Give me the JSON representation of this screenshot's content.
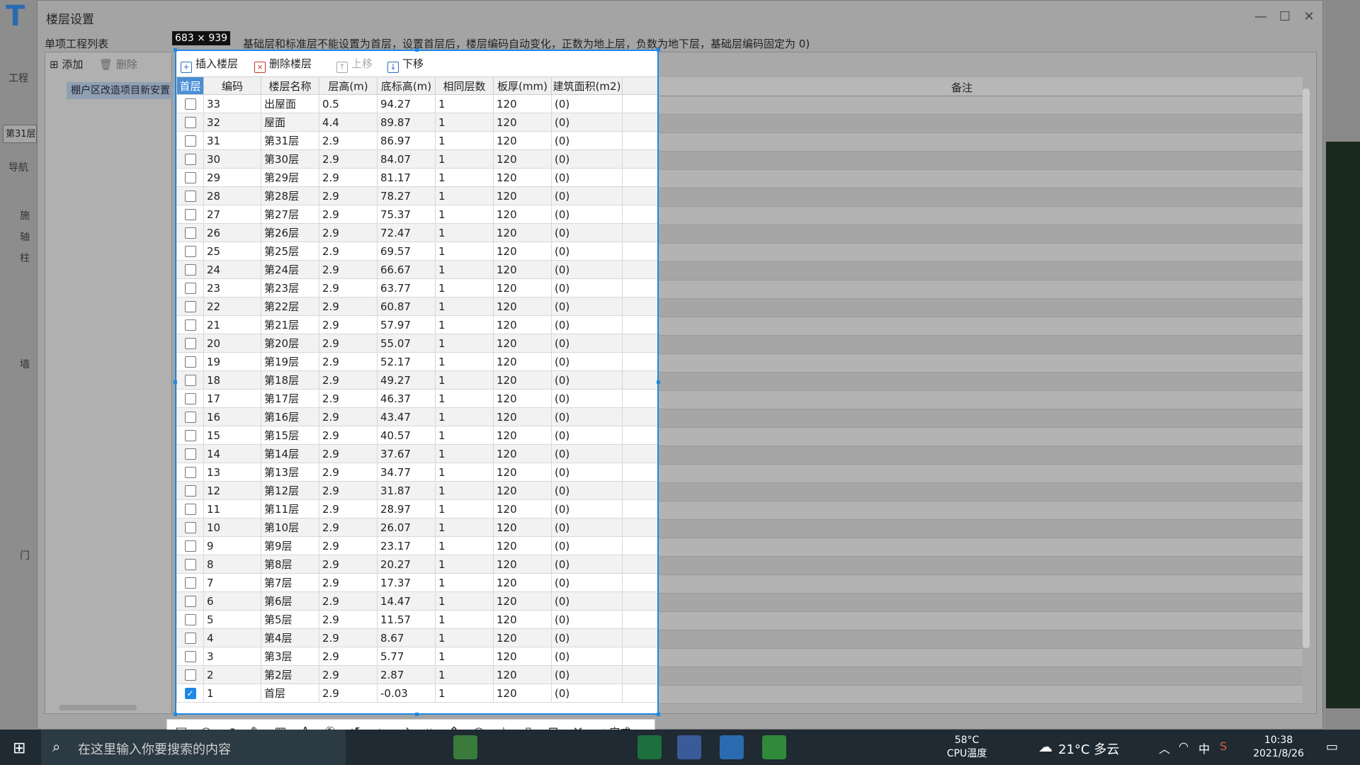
{
  "background_app": {
    "side_labels": [
      "工程",
      "导航",
      "施",
      "轴",
      "柱",
      "墙",
      "门"
    ],
    "floor_tab": "第31层"
  },
  "dialog": {
    "title": "楼层设置",
    "project_list_title": "单项工程列表",
    "add_label": "添加",
    "delete_label": "删除",
    "project_item": "棚户区改造项目新安置",
    "note": "基础层和标准层不能设置为首层，设置首层后，楼层编码自动变化，正数为地上层，负数为地下层，基础层编码固定为 0)",
    "remark_header": "备注"
  },
  "screenshot": {
    "size_label": "683 × 939",
    "toolbar": {
      "insert_floor": "插入楼层",
      "delete_floor": "删除楼层",
      "move_up": "上移",
      "move_down": "下移"
    },
    "columns": [
      "首层",
      "编码",
      "楼层名称",
      "层高(m)",
      "底标高(m)",
      "相同层数",
      "板厚(mm)",
      "建筑面积(m2)"
    ],
    "rows": [
      {
        "first": false,
        "code": "33",
        "name": "出屋面",
        "height": "0.5",
        "bottom": "94.27",
        "same": "1",
        "slab": "120",
        "area": "(0)"
      },
      {
        "first": false,
        "code": "32",
        "name": "屋面",
        "height": "4.4",
        "bottom": "89.87",
        "same": "1",
        "slab": "120",
        "area": "(0)"
      },
      {
        "first": false,
        "code": "31",
        "name": "第31层",
        "height": "2.9",
        "bottom": "86.97",
        "same": "1",
        "slab": "120",
        "area": "(0)"
      },
      {
        "first": false,
        "code": "30",
        "name": "第30层",
        "height": "2.9",
        "bottom": "84.07",
        "same": "1",
        "slab": "120",
        "area": "(0)"
      },
      {
        "first": false,
        "code": "29",
        "name": "第29层",
        "height": "2.9",
        "bottom": "81.17",
        "same": "1",
        "slab": "120",
        "area": "(0)"
      },
      {
        "first": false,
        "code": "28",
        "name": "第28层",
        "height": "2.9",
        "bottom": "78.27",
        "same": "1",
        "slab": "120",
        "area": "(0)"
      },
      {
        "first": false,
        "code": "27",
        "name": "第27层",
        "height": "2.9",
        "bottom": "75.37",
        "same": "1",
        "slab": "120",
        "area": "(0)"
      },
      {
        "first": false,
        "code": "26",
        "name": "第26层",
        "height": "2.9",
        "bottom": "72.47",
        "same": "1",
        "slab": "120",
        "area": "(0)"
      },
      {
        "first": false,
        "code": "25",
        "name": "第25层",
        "height": "2.9",
        "bottom": "69.57",
        "same": "1",
        "slab": "120",
        "area": "(0)"
      },
      {
        "first": false,
        "code": "24",
        "name": "第24层",
        "height": "2.9",
        "bottom": "66.67",
        "same": "1",
        "slab": "120",
        "area": "(0)"
      },
      {
        "first": false,
        "code": "23",
        "name": "第23层",
        "height": "2.9",
        "bottom": "63.77",
        "same": "1",
        "slab": "120",
        "area": "(0)"
      },
      {
        "first": false,
        "code": "22",
        "name": "第22层",
        "height": "2.9",
        "bottom": "60.87",
        "same": "1",
        "slab": "120",
        "area": "(0)"
      },
      {
        "first": false,
        "code": "21",
        "name": "第21层",
        "height": "2.9",
        "bottom": "57.97",
        "same": "1",
        "slab": "120",
        "area": "(0)"
      },
      {
        "first": false,
        "code": "20",
        "name": "第20层",
        "height": "2.9",
        "bottom": "55.07",
        "same": "1",
        "slab": "120",
        "area": "(0)"
      },
      {
        "first": false,
        "code": "19",
        "name": "第19层",
        "height": "2.9",
        "bottom": "52.17",
        "same": "1",
        "slab": "120",
        "area": "(0)"
      },
      {
        "first": false,
        "code": "18",
        "name": "第18层",
        "height": "2.9",
        "bottom": "49.27",
        "same": "1",
        "slab": "120",
        "area": "(0)"
      },
      {
        "first": false,
        "code": "17",
        "name": "第17层",
        "height": "2.9",
        "bottom": "46.37",
        "same": "1",
        "slab": "120",
        "area": "(0)"
      },
      {
        "first": false,
        "code": "16",
        "name": "第16层",
        "height": "2.9",
        "bottom": "43.47",
        "same": "1",
        "slab": "120",
        "area": "(0)"
      },
      {
        "first": false,
        "code": "15",
        "name": "第15层",
        "height": "2.9",
        "bottom": "40.57",
        "same": "1",
        "slab": "120",
        "area": "(0)"
      },
      {
        "first": false,
        "code": "14",
        "name": "第14层",
        "height": "2.9",
        "bottom": "37.67",
        "same": "1",
        "slab": "120",
        "area": "(0)"
      },
      {
        "first": false,
        "code": "13",
        "name": "第13层",
        "height": "2.9",
        "bottom": "34.77",
        "same": "1",
        "slab": "120",
        "area": "(0)"
      },
      {
        "first": false,
        "code": "12",
        "name": "第12层",
        "height": "2.9",
        "bottom": "31.87",
        "same": "1",
        "slab": "120",
        "area": "(0)"
      },
      {
        "first": false,
        "code": "11",
        "name": "第11层",
        "height": "2.9",
        "bottom": "28.97",
        "same": "1",
        "slab": "120",
        "area": "(0)"
      },
      {
        "first": false,
        "code": "10",
        "name": "第10层",
        "height": "2.9",
        "bottom": "26.07",
        "same": "1",
        "slab": "120",
        "area": "(0)"
      },
      {
        "first": false,
        "code": "9",
        "name": "第9层",
        "height": "2.9",
        "bottom": "23.17",
        "same": "1",
        "slab": "120",
        "area": "(0)"
      },
      {
        "first": false,
        "code": "8",
        "name": "第8层",
        "height": "2.9",
        "bottom": "20.27",
        "same": "1",
        "slab": "120",
        "area": "(0)"
      },
      {
        "first": false,
        "code": "7",
        "name": "第7层",
        "height": "2.9",
        "bottom": "17.37",
        "same": "1",
        "slab": "120",
        "area": "(0)"
      },
      {
        "first": false,
        "code": "6",
        "name": "第6层",
        "height": "2.9",
        "bottom": "14.47",
        "same": "1",
        "slab": "120",
        "area": "(0)"
      },
      {
        "first": false,
        "code": "5",
        "name": "第5层",
        "height": "2.9",
        "bottom": "11.57",
        "same": "1",
        "slab": "120",
        "area": "(0)"
      },
      {
        "first": false,
        "code": "4",
        "name": "第4层",
        "height": "2.9",
        "bottom": "8.67",
        "same": "1",
        "slab": "120",
        "area": "(0)"
      },
      {
        "first": false,
        "code": "3",
        "name": "第3层",
        "height": "2.9",
        "bottom": "5.77",
        "same": "1",
        "slab": "120",
        "area": "(0)"
      },
      {
        "first": false,
        "code": "2",
        "name": "第2层",
        "height": "2.9",
        "bottom": "2.87",
        "same": "1",
        "slab": "120",
        "area": "(0)"
      },
      {
        "first": true,
        "code": "1",
        "name": "首层",
        "height": "2.9",
        "bottom": "-0.03",
        "same": "1",
        "slab": "120",
        "area": "(0)"
      }
    ],
    "snap_tools": [
      "rectangle-icon",
      "ellipse-icon",
      "arrow-icon",
      "pen-icon",
      "mosaic-icon",
      "text-icon",
      "number-icon",
      "undo-icon",
      "pin-icon",
      "translate-icon",
      "ocr-icon",
      "long-shot-icon",
      "record-icon",
      "download-icon",
      "save-icon",
      "bookmark-icon",
      "cancel-icon"
    ],
    "done_label": "完成"
  },
  "taskbar": {
    "search_placeholder": "在这里输入你要搜索的内容",
    "cpu_temp": "58°C",
    "cpu_label": "CPU温度",
    "weather": "21°C 多云",
    "time": "10:38",
    "date": "2021/8/26"
  },
  "colors": {
    "accent": "#1f88e5",
    "header_first": "#4a8fd6",
    "taskbar": "#1f2a33"
  }
}
